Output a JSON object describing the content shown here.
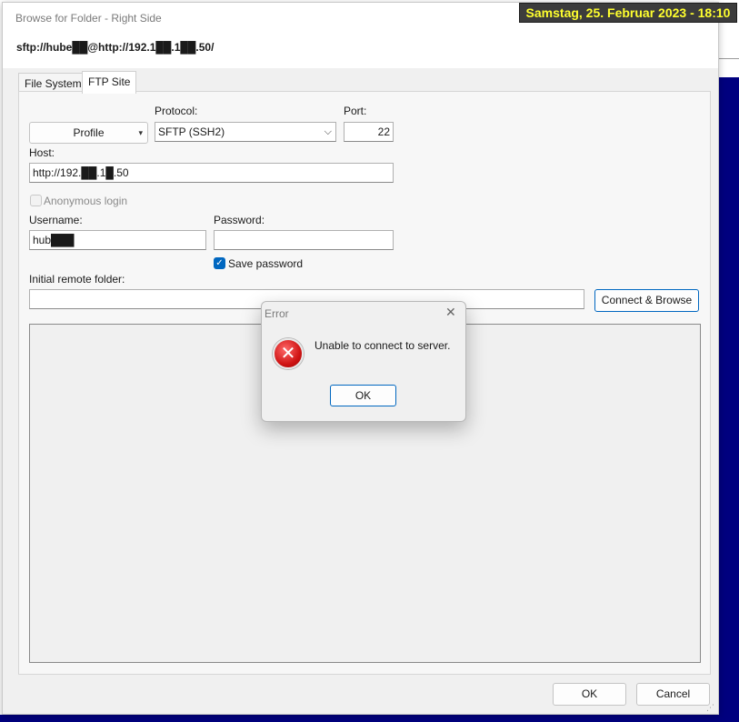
{
  "clock": "Samstag, 25. Februar 2023 - 18:10",
  "window": {
    "title": "Browse for Folder - Right Side",
    "connection": "sftp://hube██@http://192.1██.1██.50/"
  },
  "tabs": {
    "file_system": "File System",
    "ftp_site": "FTP Site"
  },
  "form": {
    "profile_button": "Profile",
    "protocol_label": "Protocol:",
    "protocol_value": "SFTP (SSH2)",
    "port_label": "Port:",
    "port_value": "22",
    "host_label": "Host:",
    "host_value": "http://192.██.1█.50",
    "anonymous_label": "Anonymous login",
    "username_label": "Username:",
    "username_value": "hub███",
    "password_label": "Password:",
    "password_value": "",
    "save_password_label": "Save password",
    "initial_folder_label": "Initial remote folder:",
    "initial_folder_value": "",
    "connect_browse": "Connect & Browse"
  },
  "footer": {
    "ok": "OK",
    "cancel": "Cancel"
  },
  "error_dialog": {
    "title": "Error",
    "message": "Unable to connect to server.",
    "ok": "OK"
  },
  "icons": {
    "error": "error-icon",
    "close": "close-icon",
    "dropdown": "chevron-down-icon",
    "check": "checkmark-icon"
  },
  "colors": {
    "clock_bg": "#3c3c3c",
    "clock_text": "#ffff2e",
    "accent": "#0067c0",
    "desktop": "#00007f",
    "error_red": "#d01414"
  }
}
